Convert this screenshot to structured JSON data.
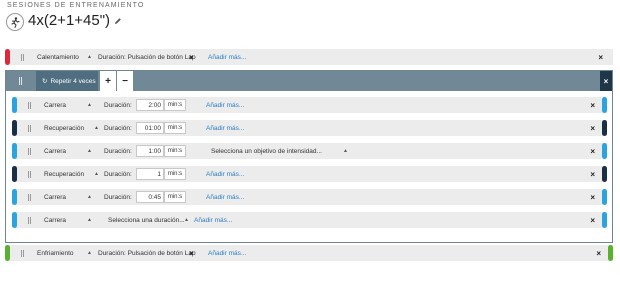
{
  "header": {
    "section_label": "SESIONES DE ENTRENAMIENTO",
    "title": "4x(2+1+45\")"
  },
  "colors": {
    "warmup": "#e0283c",
    "run": "#2aa3de",
    "recovery": "#1b2f44",
    "cooldown": "#5ab02f",
    "repeat_header": "#718897",
    "link": "#2a7ec1"
  },
  "warmup": {
    "type": "Calentamiento",
    "duration_label": "Duración: Pulsación de botón Lap",
    "add_more": "Añadir más..."
  },
  "repeat": {
    "label": "Repetir 4 veces",
    "plus": "+",
    "minus": "−",
    "close": "×"
  },
  "steps": [
    {
      "type": "Carrera",
      "duration_label": "Duración:",
      "value": "2:00",
      "unit": "min:s",
      "extra": "Añadir más..."
    },
    {
      "type": "Recuperación",
      "duration_label": "Duración:",
      "value": "01:00",
      "unit": "min:s",
      "extra": "Añadir más..."
    },
    {
      "type": "Carrera",
      "duration_label": "Duración:",
      "value": "1:00",
      "unit": "min:s",
      "extra": "Selecciona un objetivo de intensidad..."
    },
    {
      "type": "Recuperación",
      "duration_label": "Duración:",
      "value": "1",
      "unit": "min:s",
      "extra": "Añadir más..."
    },
    {
      "type": "Carrera",
      "duration_label": "Duración:",
      "value": "0:45",
      "unit": "min:s",
      "extra": "Añadir más..."
    },
    {
      "type": "Carrera",
      "select_duration": "Selecciona una duración...",
      "extra": "Añadir más..."
    }
  ],
  "cooldown": {
    "type": "Enfriamiento",
    "duration_label": "Duración: Pulsación de botón Lap",
    "add_more": "Añadir más..."
  },
  "close_glyph": "×"
}
